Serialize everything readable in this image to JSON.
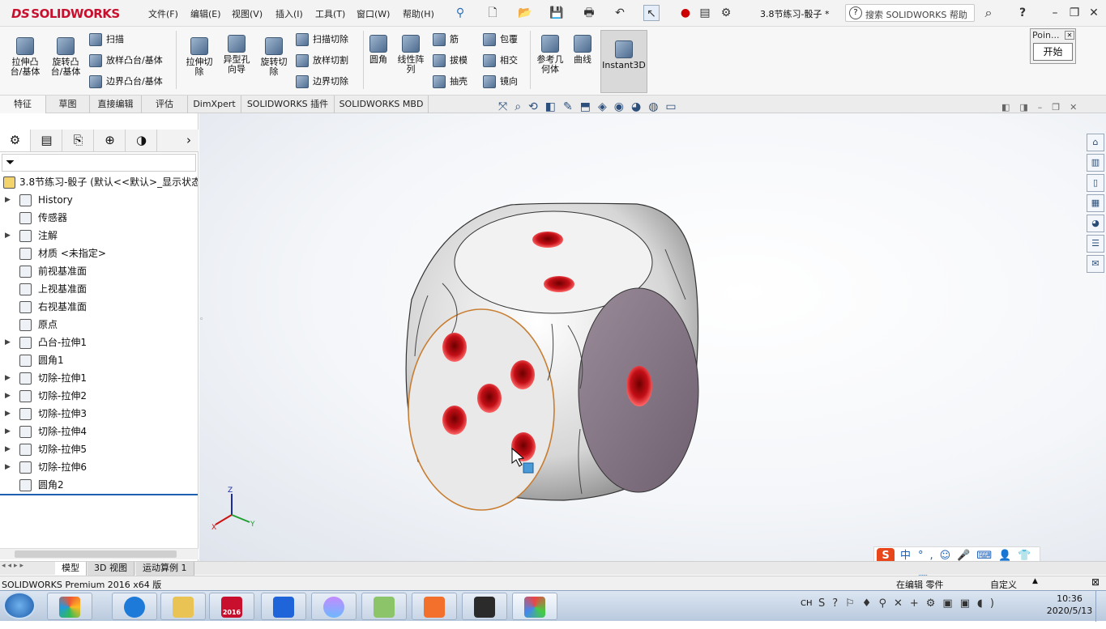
{
  "app": {
    "brand_ds": "DS",
    "brand_name": "SOLIDWORKS"
  },
  "menu": [
    "文件(F)",
    "编辑(E)",
    "视图(V)",
    "插入(I)",
    "工具(T)",
    "窗口(W)",
    "帮助(H)"
  ],
  "document_title": "3.8节练习-骰子 *",
  "search": {
    "placeholder": "搜索 SOLIDWORKS 帮助"
  },
  "help_icon_label": "?",
  "ribbon": {
    "extrude_boss": "拉伸凸\n台/基体",
    "revolve_boss": "旋转凸\n台/基体",
    "sweep": "扫描",
    "loft_boss": "放样凸台/基体",
    "boundary_boss": "边界凸台/基体",
    "extrude_cut": "拉伸切\n除",
    "hole_wizard": "异型孔\n向导",
    "revolve_cut": "旋转切\n除",
    "sweep_cut": "扫描切除",
    "loft_cut": "放样切割",
    "boundary_cut": "边界切除",
    "fillet": "圆角",
    "linear_pattern": "线性阵\n列",
    "rib": "筋",
    "draft": "拔模",
    "shell": "抽壳",
    "wrap": "包覆",
    "intersect": "相交",
    "mirror": "镜向",
    "ref_geometry": "参考几\n何体",
    "curves": "曲线",
    "instant3d": "Instant3D"
  },
  "point_panel": {
    "title": "Poin...",
    "start": "开始"
  },
  "command_tabs": [
    "特征",
    "草图",
    "直接编辑",
    "评估",
    "DimXpert",
    "SOLIDWORKS 插件",
    "SOLIDWORKS MBD"
  ],
  "feature_tree": {
    "root": "3.8节练习-骰子 (默认<<默认>_显示状态",
    "items": [
      {
        "label": "History",
        "expand": true
      },
      {
        "label": "传感器",
        "expand": false
      },
      {
        "label": "注解",
        "expand": true
      },
      {
        "label": "材质 <未指定>",
        "expand": false
      },
      {
        "label": "前视基准面",
        "expand": false
      },
      {
        "label": "上视基准面",
        "expand": false
      },
      {
        "label": "右视基准面",
        "expand": false
      },
      {
        "label": "原点",
        "expand": false
      },
      {
        "label": "凸台-拉伸1",
        "expand": true
      },
      {
        "label": "圆角1",
        "expand": false
      },
      {
        "label": "切除-拉伸1",
        "expand": true
      },
      {
        "label": "切除-拉伸2",
        "expand": true
      },
      {
        "label": "切除-拉伸3",
        "expand": true
      },
      {
        "label": "切除-拉伸4",
        "expand": true
      },
      {
        "label": "切除-拉伸5",
        "expand": true
      },
      {
        "label": "切除-拉伸6",
        "expand": true
      },
      {
        "label": "圆角2",
        "expand": false
      }
    ]
  },
  "triad": {
    "x": "X",
    "y": "Y",
    "z": "Z"
  },
  "bottom_tabs": [
    "模型",
    "3D 视图",
    "运动算例 1"
  ],
  "status": {
    "left": "SOLIDWORKS Premium 2016 x64 版",
    "mode": "在编辑 零件",
    "custom": "自定义"
  },
  "ime": {
    "logo": "S",
    "lang": "中"
  },
  "taskbar": {
    "lang": "CH",
    "time": "10:36",
    "date": "2020/5/13",
    "sw_badge": "2016"
  },
  "colors": {
    "accent": "#c8102e",
    "hole_red": "#d4141e",
    "selected_face": "#8b7a8a",
    "panel_blue": "#2a4d78"
  }
}
